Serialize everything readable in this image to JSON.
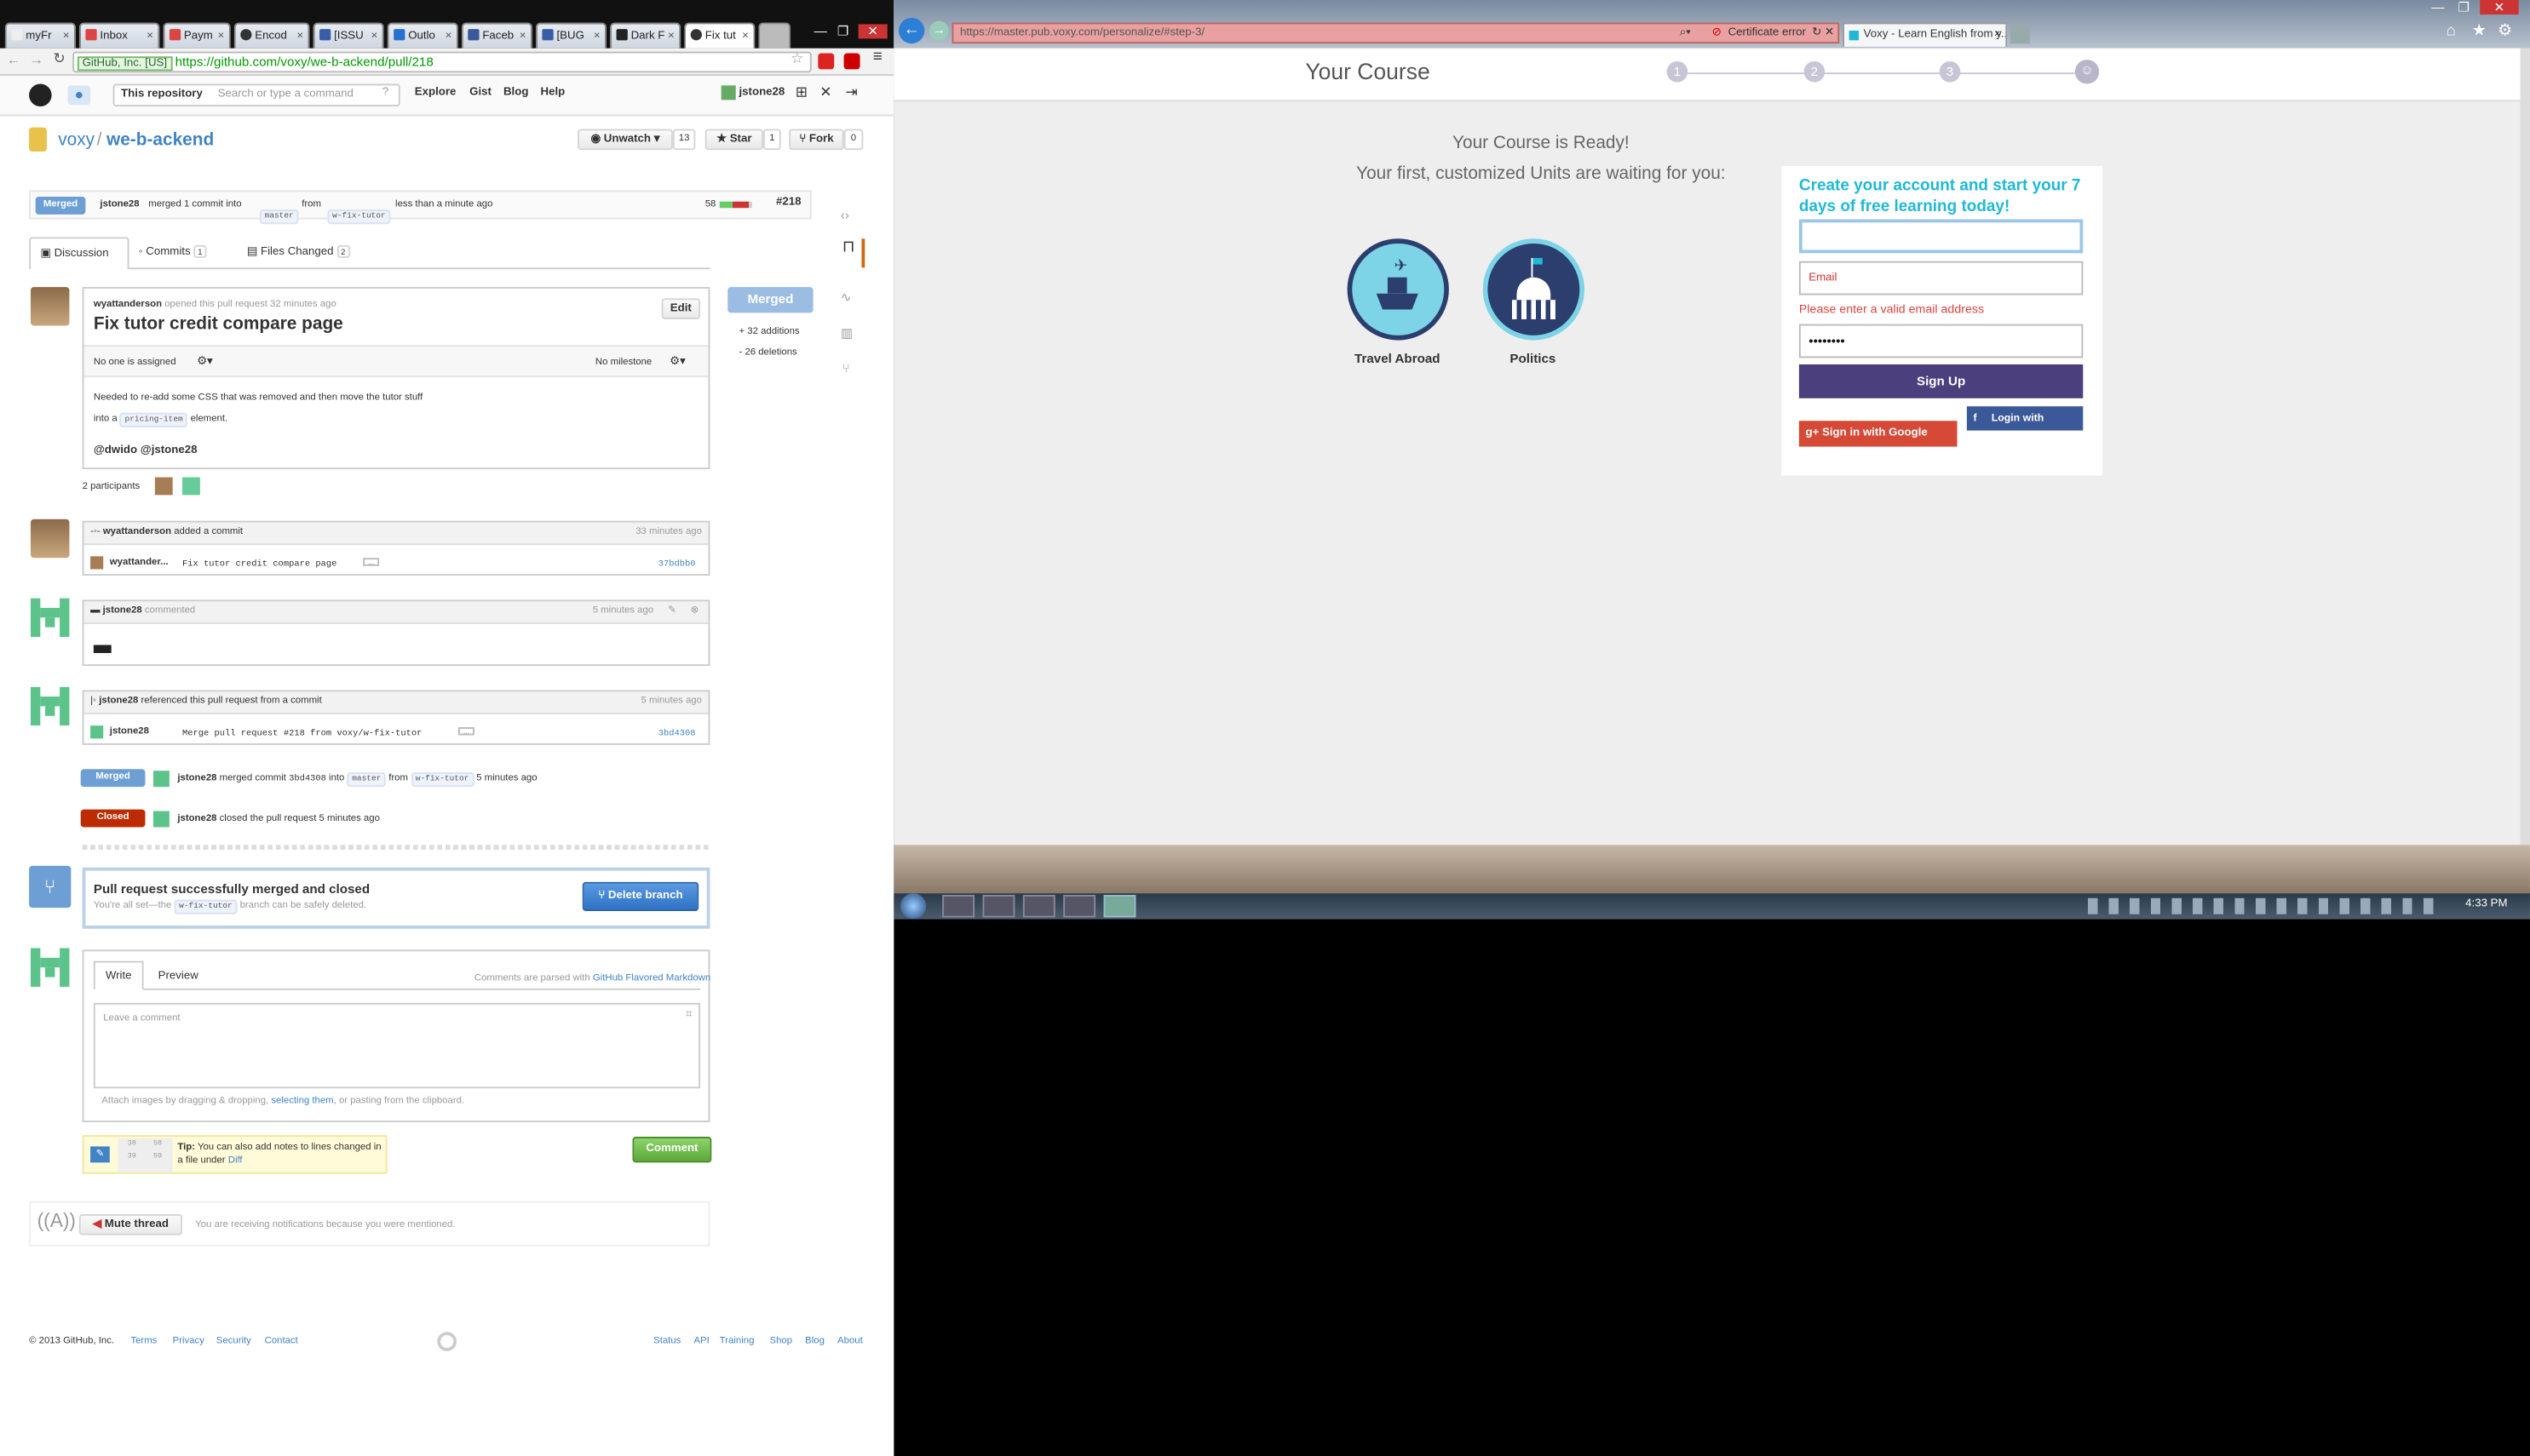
{
  "left": {
    "tabs": [
      "myFr",
      "Inbox",
      "Paym",
      "Encod",
      "[ISSU",
      "Outlo",
      "Faceb",
      "[BUG",
      "Dark F",
      "Fix tut"
    ],
    "url_ev": "GitHub, Inc. [US]",
    "url": "https://github.com/voxy/we-b-ackend/pull/218",
    "nav": {
      "scope": "This repository",
      "search_placeholder": "Search or type a command",
      "links": [
        "Explore",
        "Gist",
        "Blog",
        "Help"
      ],
      "user": "jstone28"
    },
    "repo": {
      "owner": "voxy",
      "sep": "/",
      "name": "we-b-ackend",
      "unwatch": "Unwatch",
      "unwatch_count": "13",
      "star": "Star",
      "star_count": "1",
      "fork": "Fork",
      "fork_count": "0"
    },
    "pr_meta": {
      "state": "Merged",
      "user": "jstone28",
      "action": "merged 1 commit into",
      "base": "master",
      "from": "from",
      "head": "w-fix-tutor",
      "time": "less than a minute ago",
      "diffcount": "58",
      "number": "#218"
    },
    "pr_tabs": [
      {
        "label": "Discussion",
        "count": ""
      },
      {
        "label": "Commits",
        "count": "1"
      },
      {
        "label": "Files Changed",
        "count": "2"
      }
    ],
    "discussion": {
      "author": "wyattanderson",
      "opened": "opened this pull request 32 minutes ago",
      "edit": "Edit",
      "title": "Fix tutor credit compare page",
      "assignee": "No one is assigned",
      "milestone": "No milestone",
      "body1": "Needed to re-add some CSS that was removed and then move the tutor stuff",
      "body2a": "into a",
      "body2code": "pricing-item",
      "body2b": "element.",
      "mentions": "@dwido @jstone28",
      "merged_btn": "Merged",
      "additions": "+ 32 additions",
      "deletions": "- 26 deletions",
      "participants": "2 participants"
    },
    "events": {
      "commit": {
        "user": "wyattanderson",
        "text": "added a commit",
        "time": "33 minutes ago",
        "author": "wyattander...",
        "msg": "Fix tutor credit compare page",
        "sha": "37bdbb0"
      },
      "comment": {
        "user": "jstone28",
        "text": "commented",
        "time": "5 minutes ago"
      },
      "ref": {
        "user": "jstone28",
        "text": "referenced this pull request from a commit",
        "time": "5 minutes ago",
        "author": "jstone28",
        "msg": "Merge pull request #218 from voxy/w-fix-tutor",
        "sha": "3bd4308"
      },
      "merged": {
        "label": "Merged",
        "user": "jstone28",
        "text": "merged commit",
        "sha": "3bd4308",
        "into": "into",
        "base": "master",
        "from": "from",
        "head": "w-fix-tutor",
        "time": "5 minutes ago"
      },
      "closed": {
        "label": "Closed",
        "user": "jstone28",
        "text": "closed the pull request 5 minutes ago"
      }
    },
    "merged_box": {
      "title": "Pull request successfully merged and closed",
      "sub1": "You're all set—the",
      "branch": "w-fix-tutor",
      "sub2": "branch can be safely deleted.",
      "delete": "Delete branch"
    },
    "comment_form": {
      "write": "Write",
      "preview": "Preview",
      "parsed": "Comments are parsed with",
      "gfm": "GitHub Flavored Markdown",
      "placeholder": "Leave a comment",
      "attach1": "Attach images by dragging & dropping,",
      "attach_link": "selecting them",
      "attach2": ", or pasting from the clipboard.",
      "submit": "Comment"
    },
    "tip": {
      "bold": "Tip:",
      "text": "You can also add notes to lines changed in a file under",
      "link": "Diff",
      "nums": [
        "38",
        "58",
        "39",
        "59"
      ]
    },
    "mute": {
      "label": "Mute thread",
      "note": "You are receiving notifications because you were mentioned."
    },
    "footer": {
      "copy": "© 2013 GitHub, Inc.",
      "links": [
        "Terms",
        "Privacy",
        "Security",
        "Contact"
      ],
      "right": [
        "Status",
        "API",
        "Training",
        "Shop",
        "Blog",
        "About"
      ]
    }
  },
  "right": {
    "tabs": [
      "Voxy - Learn English from y..."
    ],
    "url": "https://master.pub.voxy.com/personalize/#step-3/",
    "cert": "Certificate error",
    "heading": "Your Course",
    "steps": [
      "1",
      "2",
      "3"
    ],
    "ready": "Your Course is Ready!",
    "waiting": "Your first, customized Units are waiting for you:",
    "units": [
      "Travel Abroad",
      "Politics"
    ],
    "form": {
      "title": "Create your account and start your 7 days of free learning today!",
      "email_placeholder": "Email",
      "error": "Please enter a valid email address",
      "password": "••••••••",
      "signup": "Sign Up",
      "google": "Sign in with Google",
      "facebook": "Login with"
    },
    "clock": "4:33 PM"
  },
  "colors": {
    "merged": "#6e5494",
    "closed": "#bd2c00",
    "voxy_teal": "#1fb9d6",
    "voxy_navy": "#4b3f7d",
    "github_blue": "#4183c4"
  }
}
